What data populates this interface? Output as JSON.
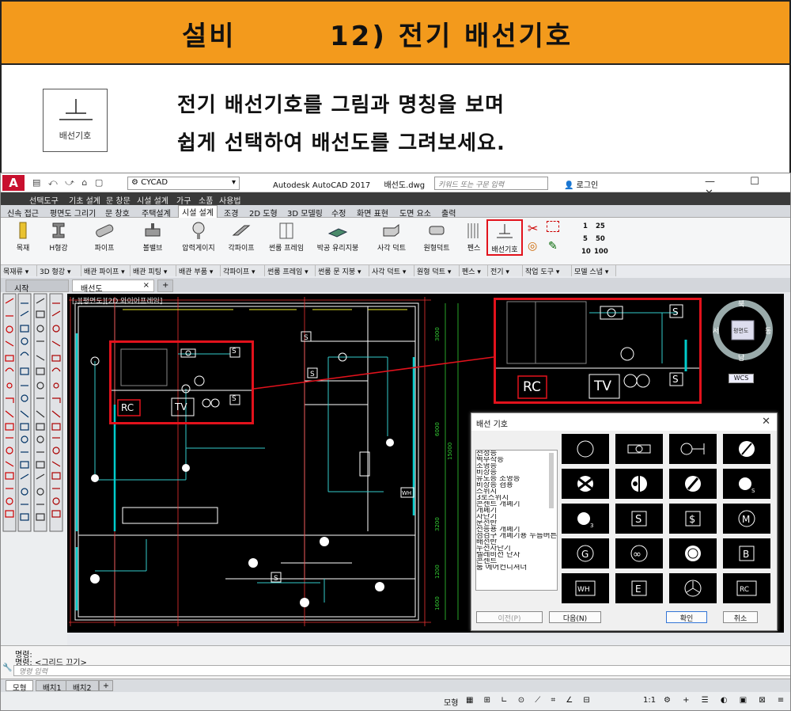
{
  "banner": {
    "category": "설비",
    "title": "12) 전기 배선기호"
  },
  "intro": {
    "icon_label": "배선기호",
    "line1": "전기 배선기호를 그림과 명칭을 보며",
    "line2": "쉽게 선택하여 배선도를 그려보세요."
  },
  "app": {
    "logo": "A",
    "workspace": "CYCAD",
    "title": "Autodesk AutoCAD 2017",
    "file": "배선도.dwg",
    "search_placeholder": "키워드 또는 구문 입력",
    "login": "로그인"
  },
  "menu": [
    "선택도구",
    "기초 설계",
    "문 창문",
    "시설 설계",
    "가구",
    "소품",
    "사용법"
  ],
  "ribbon_tabs": [
    "신속 접근",
    "평면도 그리기",
    "문 창호",
    "주택설계",
    "시설 설계",
    "조경",
    "2D 도형",
    "3D 모델링",
    "수정",
    "화면 표현",
    "도면 요소",
    "출력"
  ],
  "active_tab": "시설 설계",
  "ribbon_buttons": [
    "목재",
    "H형강",
    "파이프",
    "볼밸브",
    "압력게이지",
    "각파이프",
    "썬룸 프레임",
    "박공 유리지붕",
    "사각 덕트",
    "원형덕트",
    "펜스",
    "배선기호"
  ],
  "ribbon_panels": [
    "목재류 ▾",
    "3D 형강 ▾",
    "배관 파이프 ▾",
    "배관 피팅 ▾",
    "배관 부품 ▾",
    "각파이프 ▾",
    "썬룸 프레임 ▾",
    "썬룸 문 지붕 ▾",
    "사각 덕트 ▾",
    "원형 덕트 ▾",
    "펜스 ▾",
    "전기 ▾",
    "작업 도구 ▾",
    "모델 스냅 ▾"
  ],
  "scale_labels": [
    "1",
    "25",
    "5",
    "50",
    "10",
    "100"
  ],
  "doc_tabs": {
    "start": "시작",
    "current": "배선도"
  },
  "canvas": {
    "view_label": "[-][평면도][2D 와이어프레임]",
    "dims": [
      "3000",
      "6000",
      "15000",
      "3200",
      "1200",
      "1600"
    ],
    "labels": {
      "rc": "RC",
      "tv": "TV",
      "s": "S",
      "wh": "WH"
    }
  },
  "viewcube": {
    "north": "북",
    "south": "남",
    "east": "동",
    "west": "서",
    "top": "평면도",
    "wcs": "WCS"
  },
  "dialog": {
    "title": "배선 기호",
    "list": [
      "천정등",
      "벽부착등",
      "조명등",
      "비상등",
      "유도등 조명등",
      "비상등 겸용",
      "스위치",
      "3로스위치",
      "콘센트 개폐기",
      "개폐기",
      "차단기",
      "분전반",
      "전등용 개폐기",
      "점검구 개폐기용 누름버튼",
      "배전반",
      "누전차단기",
      "텔레비전 단자",
      "콘센트",
      "룸 에어컨디셔너"
    ],
    "symbols": [
      "",
      "",
      "",
      "",
      "",
      "",
      "",
      "",
      "S",
      "$",
      "M",
      "G",
      "∞",
      "",
      "B",
      "WH",
      "E",
      "",
      "RC"
    ],
    "prev": "이전(P)",
    "next": "다음(N)",
    "ok": "확인",
    "cancel": "취소"
  },
  "command": {
    "line1": "명령:",
    "line2": "명령:  <그리드 끄기>",
    "prompt": "명령 입력"
  },
  "layout_tabs": [
    "모형",
    "배치1",
    "배치2"
  ],
  "status": {
    "model": "모형",
    "scale": "1:1"
  }
}
